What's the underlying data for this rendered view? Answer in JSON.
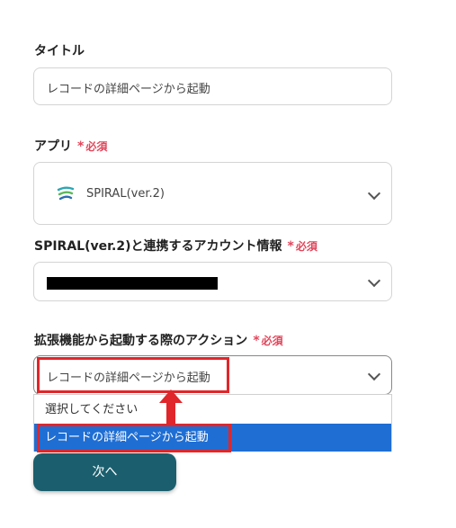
{
  "title_field": {
    "label": "タイトル",
    "value": "レコードの詳細ページから起動"
  },
  "app_field": {
    "label": "アプリ",
    "required_mark": "*",
    "required_text": "必須",
    "value": "SPIRAL(ver.2)",
    "icon": "spiral-logo-icon"
  },
  "account_field": {
    "label": "SPIRAL(ver.2)と連携するアカウント情報",
    "required_mark": "*",
    "required_text": "必須"
  },
  "action_field": {
    "label": "拡張機能から起動する際のアクション",
    "required_mark": "*",
    "required_text": "必須",
    "value": "レコードの詳細ページから起動"
  },
  "dropdown": {
    "options": [
      "選択してください",
      "レコードの詳細ページから起動"
    ],
    "selected_index": 1
  },
  "next_button": {
    "label": "次へ"
  },
  "colors": {
    "required": "#e2455a",
    "selected": "#1f6ed4",
    "highlight": "#e0262a",
    "button": "#1b5f6e"
  }
}
